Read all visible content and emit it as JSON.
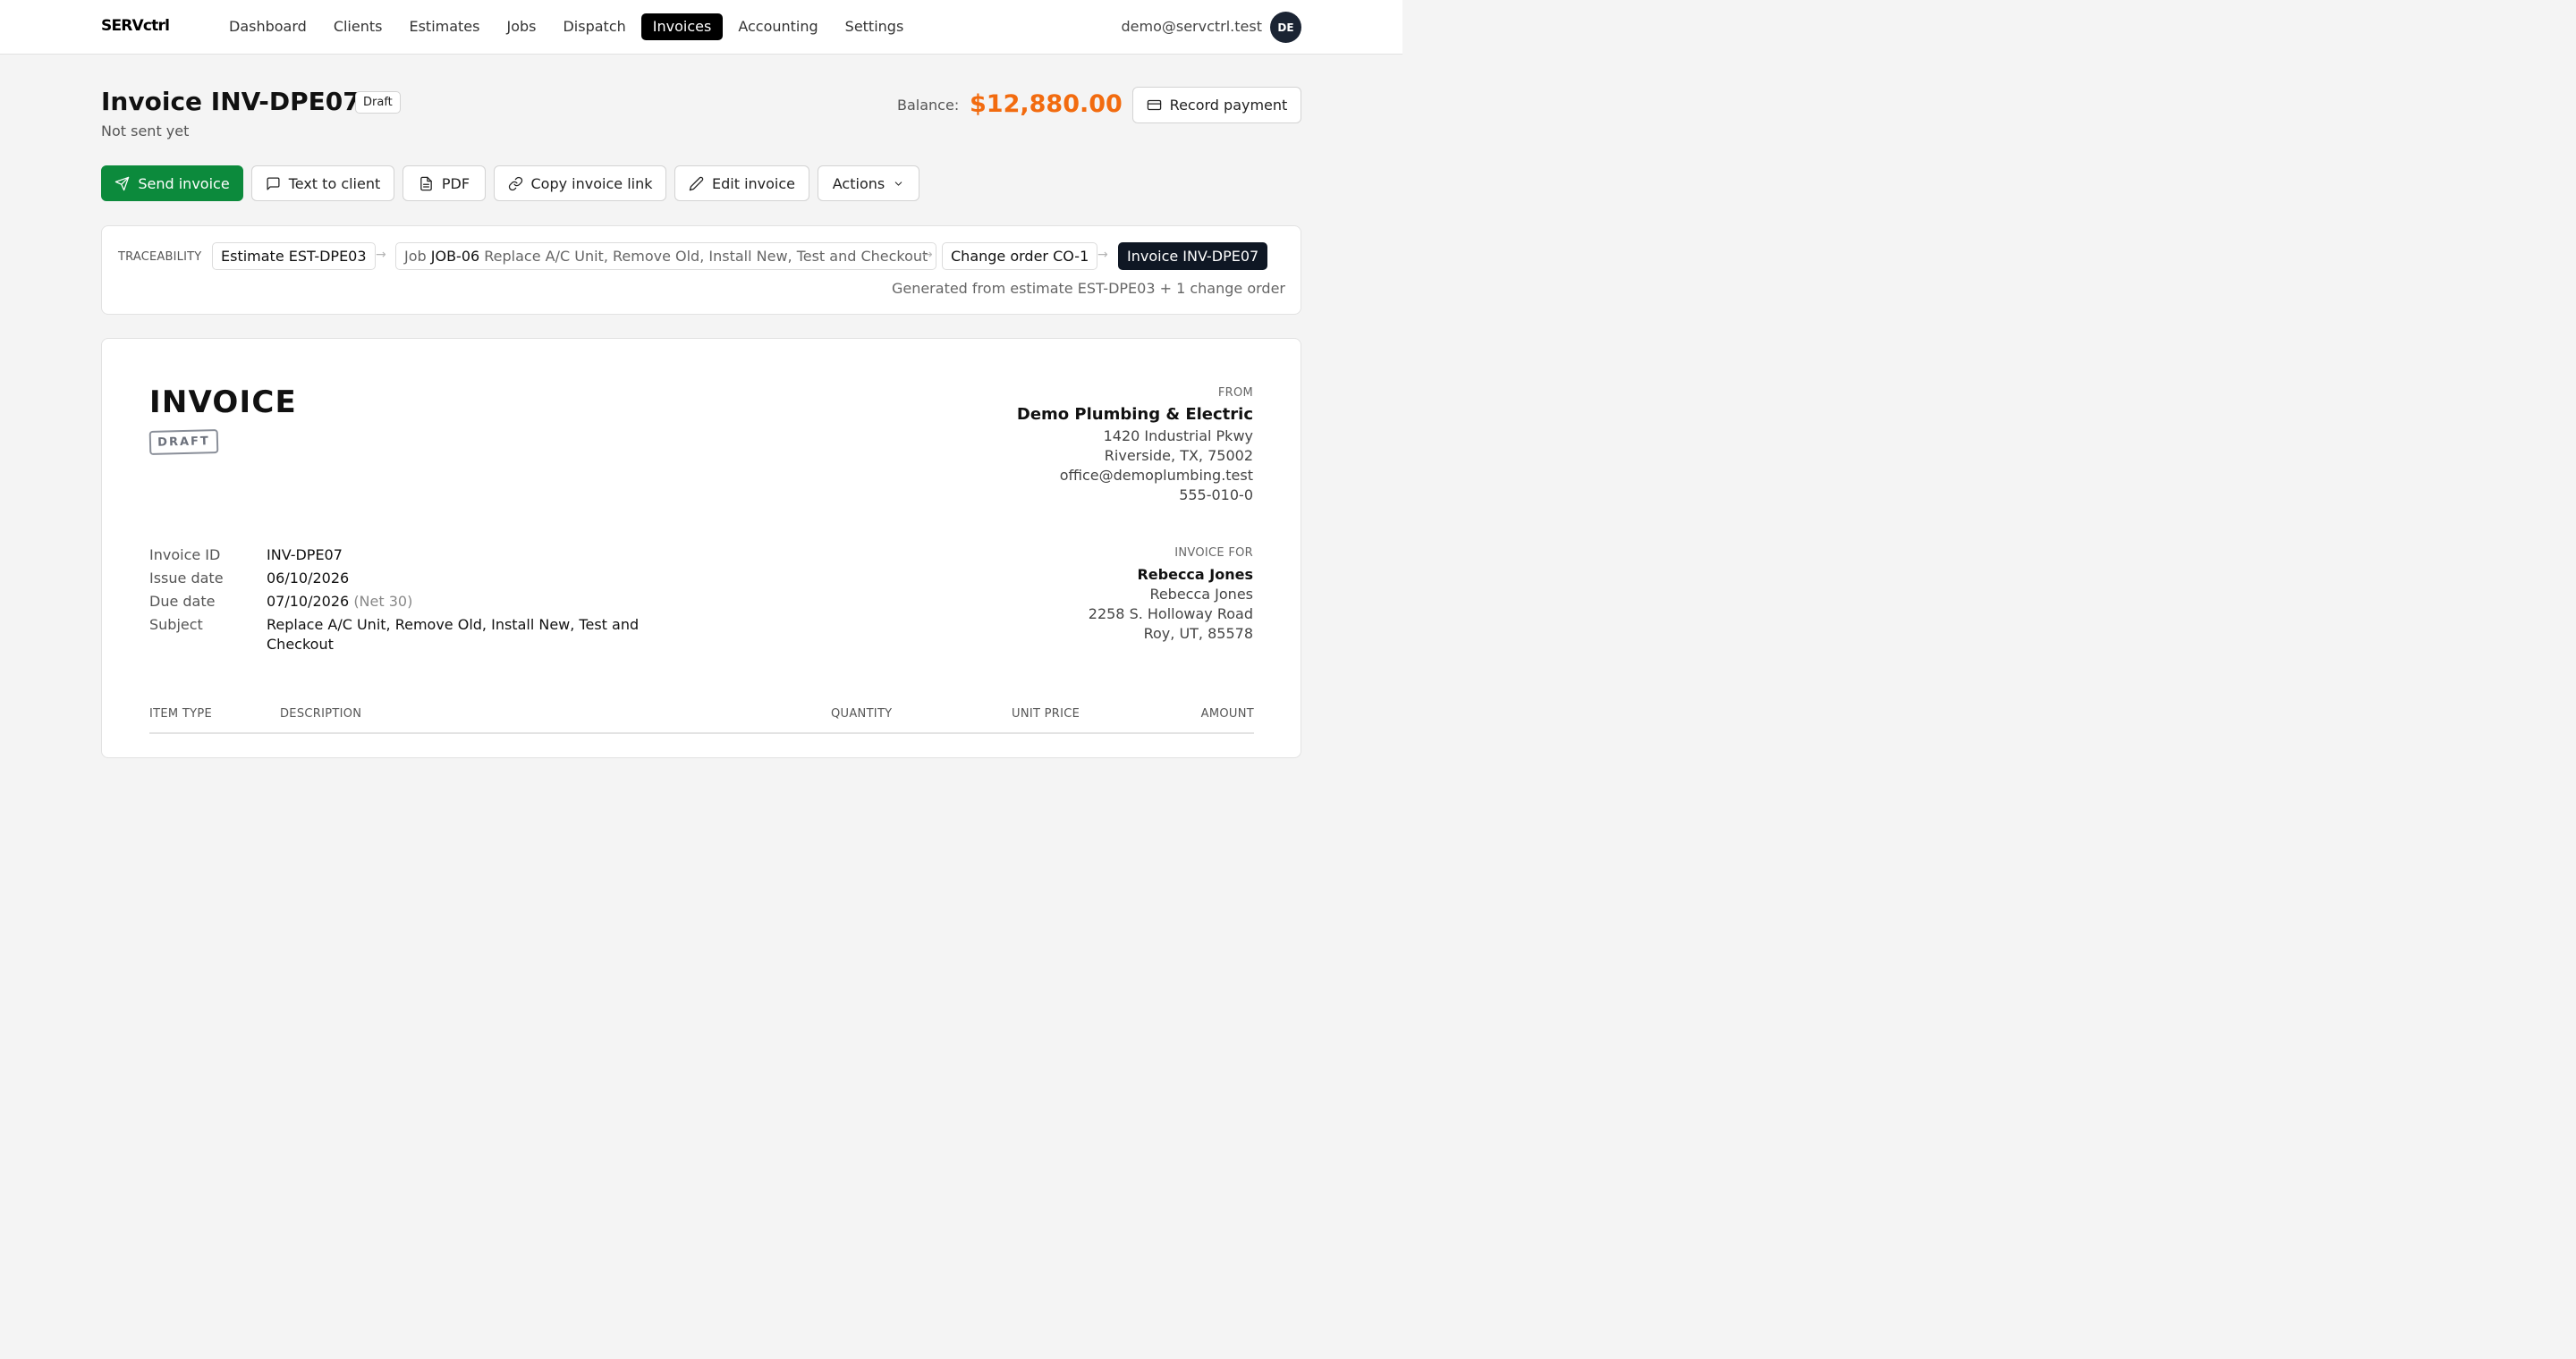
{
  "nav": {
    "brand": "SERVctrl",
    "links": [
      "Dashboard",
      "Clients",
      "Estimates",
      "Jobs",
      "Dispatch",
      "Invoices",
      "Accounting",
      "Settings"
    ],
    "active": "Invoices",
    "user_email": "demo@servctrl.test",
    "avatar_initials": "DE"
  },
  "header": {
    "title": "Invoice INV-DPE07",
    "status": "Draft",
    "subtitle": "Not sent yet",
    "balance_label": "Balance:",
    "balance_amount": "$12,880.00",
    "record_payment_label": "Record payment"
  },
  "actions": {
    "send": "Send invoice",
    "text": "Text to client",
    "pdf": "PDF",
    "copy_link": "Copy invoice link",
    "edit": "Edit invoice",
    "more": "Actions"
  },
  "traceability": {
    "label": "TRACEABILITY",
    "estimate": "Estimate EST-DPE03",
    "job_prefix": "Job",
    "job_id": "JOB-06",
    "job_desc": "Replace A/C Unit, Remove Old, Install New, Test and Checkout",
    "change_order": "Change order CO-1",
    "invoice": "Invoice INV-DPE07",
    "note": "Generated from estimate EST-DPE03 + 1 change order"
  },
  "document": {
    "title": "INVOICE",
    "stamp": "DRAFT",
    "from": {
      "label": "FROM",
      "name": "Demo Plumbing & Electric",
      "address1": "1420 Industrial Pkwy",
      "address2": "Riverside, TX, 75002",
      "email": "office@demoplumbing.test",
      "phone": "555-010-0"
    },
    "invoice_for": {
      "label": "INVOICE FOR",
      "name": "Rebecca Jones",
      "contact": "Rebecca Jones",
      "address1": "2258 S. Holloway Road",
      "address2": "Roy, UT, 85578"
    },
    "meta": {
      "invoice_id_label": "Invoice ID",
      "invoice_id": "INV-DPE07",
      "issue_date_label": "Issue date",
      "issue_date": "06/10/2026",
      "due_date_label": "Due date",
      "due_date": "07/10/2026",
      "due_terms": "(Net 30)",
      "subject_label": "Subject",
      "subject": "Replace A/C Unit, Remove Old, Install New, Test and Checkout"
    },
    "table_headers": {
      "item_type": "ITEM TYPE",
      "description": "DESCRIPTION",
      "quantity": "QUANTITY",
      "unit_price": "UNIT PRICE",
      "amount": "AMOUNT"
    }
  },
  "colors": {
    "primary_green": "#0c8a3c",
    "balance_orange": "#f26b0f",
    "dark_navy": "#0f1724"
  }
}
